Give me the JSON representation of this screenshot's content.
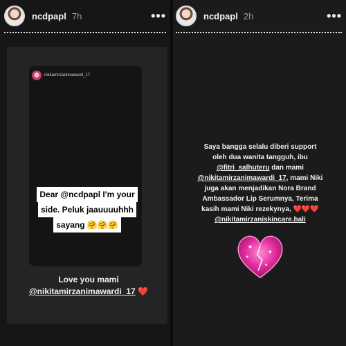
{
  "left_story": {
    "username": "ncdpapl",
    "time": "7h",
    "more": "•••",
    "shared_post": {
      "username": "nikitamirzanimawardi_17",
      "dear_lines": [
        "Dear @ncdpapl I'm your",
        "side. Peluk jaauuuuhhh",
        "sayang 🤗🤗🤗"
      ]
    },
    "caption_line1": "Love you mami",
    "caption_line2_mention": "@nikitamirzanimawardi_17",
    "caption_line2_emoji": "❤️"
  },
  "right_story": {
    "username": "ncdpapl",
    "time": "2h",
    "more": "•••",
    "caption_lines": [
      {
        "text": "Saya bangga selalu diberi support"
      },
      {
        "text": "oleh dua wanita tangguh, ibu"
      },
      {
        "text": "@fitri_salhuteru",
        "suffix": " dan mami"
      },
      {
        "text": "@nikitamirzanimawardi_17",
        "suffix": ", mami Niki"
      },
      {
        "text": "juga akan menjadikan Nora Brand"
      },
      {
        "text": "Ambassador Lip Serumnya, Terima"
      },
      {
        "text": "kasih mami Niki rezekynya, ❤️❤️❤️"
      },
      {
        "text": "@nikitamirzaniskincare.bali"
      }
    ],
    "sticker": "glitter-heart-icon"
  },
  "colors": {
    "background": "#161616",
    "text": "#f2f2f2",
    "heart_red": "#e0243a",
    "glitter_pink": "#e0289a"
  }
}
